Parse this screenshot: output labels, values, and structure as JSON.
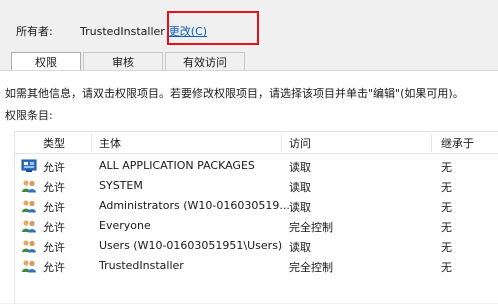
{
  "owner": {
    "label": "所有者:",
    "value": "TrustedInstaller",
    "change_link": "更改(C)"
  },
  "tabs": [
    {
      "label": "权限",
      "active": true
    },
    {
      "label": "审核",
      "active": false
    },
    {
      "label": "有效访问",
      "active": false
    }
  ],
  "info_text": "如需其他信息，请双击权限项目。若要修改权限项目，请选择该项目并单击\"编辑\"(如果可用)。",
  "entries_label": "权限条目:",
  "table": {
    "headers": {
      "type": "类型",
      "principal": "主体",
      "access": "访问",
      "inherited": "继承于"
    },
    "rows": [
      {
        "icon": "package-group-icon",
        "type": "允许",
        "principal": "ALL APPLICATION PACKAGES",
        "access": "读取",
        "inherited": "无"
      },
      {
        "icon": "users-icon",
        "type": "允许",
        "principal": "SYSTEM",
        "access": "读取",
        "inherited": "无"
      },
      {
        "icon": "users-icon",
        "type": "允许",
        "principal": "Administrators (W10-016030519...",
        "access": "读取",
        "inherited": "无"
      },
      {
        "icon": "users-icon",
        "type": "允许",
        "principal": "Everyone",
        "access": "完全控制",
        "inherited": "无"
      },
      {
        "icon": "users-icon",
        "type": "允许",
        "principal": "Users (W10-01603051951\\Users)",
        "access": "读取",
        "inherited": "无"
      },
      {
        "icon": "users-icon",
        "type": "允许",
        "principal": "TrustedInstaller",
        "access": "完全控制",
        "inherited": "无"
      }
    ]
  },
  "colors": {
    "highlight": "#e8101a",
    "link": "#0b5cbd"
  }
}
